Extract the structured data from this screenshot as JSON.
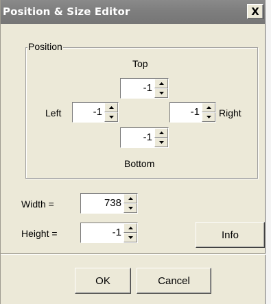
{
  "window": {
    "title": "Position & Size Editor",
    "close_symbol": "X"
  },
  "position_group": {
    "label": "Position",
    "top_label": "Top",
    "left_label": "Left",
    "right_label": "Right",
    "bottom_label": "Bottom",
    "top_value": "-1",
    "left_value": "-1",
    "right_value": "-1",
    "bottom_value": "-1"
  },
  "size": {
    "width_label": "Width =",
    "width_value": "738",
    "height_label": "Height =",
    "height_value": "-1"
  },
  "buttons": {
    "info": "Info",
    "ok": "OK",
    "cancel": "Cancel"
  },
  "icons": {
    "spinner_up": "spin-up-arrow-icon",
    "spinner_down": "spin-down-arrow-icon",
    "close": "close-icon"
  }
}
